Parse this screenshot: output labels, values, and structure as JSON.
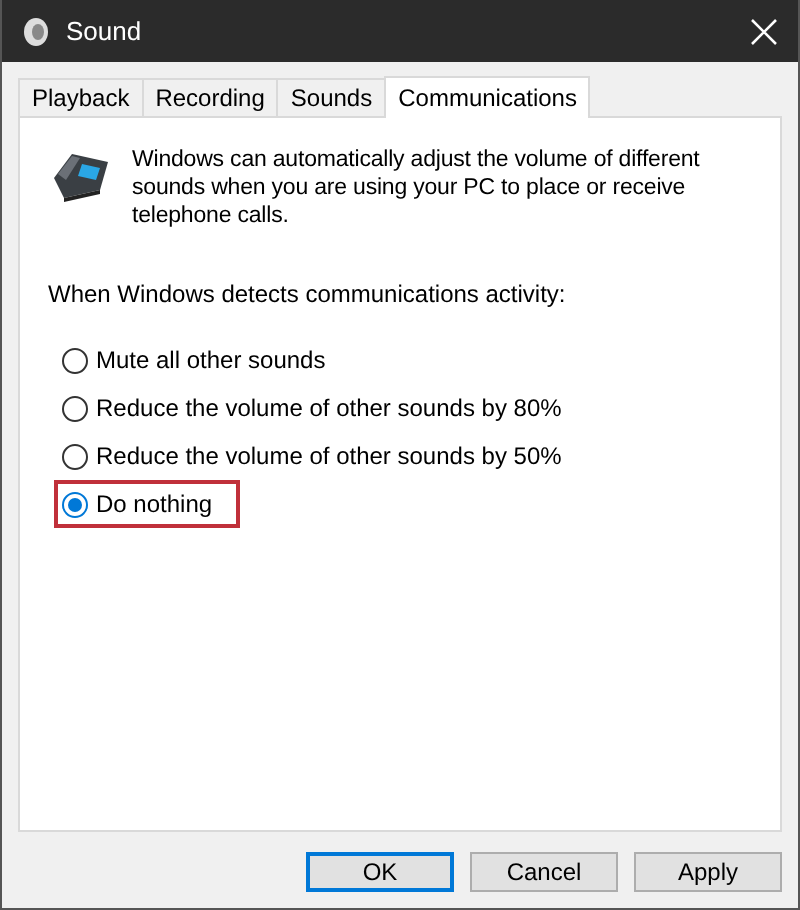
{
  "window": {
    "title": "Sound"
  },
  "tabs": [
    {
      "label": "Playback",
      "selected": false
    },
    {
      "label": "Recording",
      "selected": false
    },
    {
      "label": "Sounds",
      "selected": false
    },
    {
      "label": "Communications",
      "selected": true
    }
  ],
  "description": "Windows can automatically adjust the volume of different sounds when you are using your PC to place or receive telephone calls.",
  "prompt": "When Windows detects communications activity:",
  "options": [
    {
      "label": "Mute all other sounds",
      "selected": false,
      "highlighted": false
    },
    {
      "label": "Reduce the volume of other sounds by 80%",
      "selected": false,
      "highlighted": false
    },
    {
      "label": "Reduce the volume of other sounds by 50%",
      "selected": false,
      "highlighted": false
    },
    {
      "label": "Do nothing",
      "selected": true,
      "highlighted": true
    }
  ],
  "buttons": [
    {
      "label": "OK",
      "default": true
    },
    {
      "label": "Cancel",
      "default": false
    },
    {
      "label": "Apply",
      "default": false
    }
  ]
}
